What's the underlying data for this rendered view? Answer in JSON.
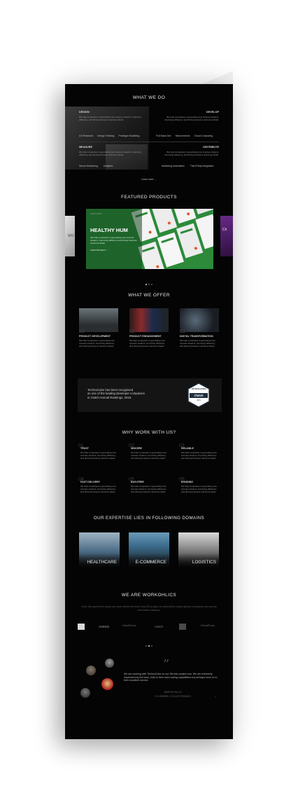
{
  "what_we_do": {
    "title": "WHAT WE DO",
    "blocks": [
      {
        "label": "DESIGN",
        "text": "We help companies in generating new revenue streams, improving efficiency, and driving business outcomes faster.",
        "items": [
          "UX Research",
          "Design Thinking",
          "Prototype Modelling"
        ]
      },
      {
        "label": "DEVELOP",
        "text": "We help companies in generating new revenue streams, improving efficiency, and driving business outcomes faster.",
        "items": [
          "Full Stack Dev",
          "Microservices",
          "Cloud Computing"
        ]
      },
      {
        "label": "MEASURE",
        "text": "We help companies in generating new revenue streams, improving efficiency, and driving business outcomes faster.",
        "items": [
          "Server Monitoring",
          "Analytics"
        ]
      },
      {
        "label": "DISTRIBUTE",
        "text": "We help companies in generating new revenue streams, improving efficiency, and driving business outcomes faster.",
        "items": [
          "Marketing Automation",
          "Third Party Integration"
        ]
      }
    ],
    "learn_more": "Learn more →"
  },
  "featured": {
    "title": "FEATURED PRODUCTS",
    "tag": "WATCHAPP",
    "product_title": "HEALTHY HUM",
    "product_text": "We help companies in generating new revenue streams, improving efficiency and driving business outcomes faster.",
    "link": "VIEW PROJECT →",
    "side_left": "WO",
    "side_right": "Ch"
  },
  "offer": {
    "title": "WHAT WE OFFER",
    "items": [
      {
        "num": "01",
        "title": "PRODUCT DEVELOPMENT",
        "text": "We help companies in generating new revenue streams, improving efficiency, and driving business outcomes faster."
      },
      {
        "num": "02",
        "title": "PRODUCT ENHANCEMENT",
        "text": "We help companies in generating new revenue streams, improving efficiency, and driving business outcomes faster."
      },
      {
        "num": "03",
        "title": "DIGITAL TRANSFORMATION",
        "text": "We help companies in generating new revenue streams, improving efficiency, and driving business outcomes faster."
      }
    ]
  },
  "clutch": {
    "line1": "TechnoCube has been recognised",
    "line2": "as one of the leading developer companies",
    "line3": "in Clutch Annual Rankings, 2019.",
    "badge_top": "TOP DEVELOPERS",
    "badge_name": "Clutch",
    "badge_year": "2019"
  },
  "why": {
    "title": "WHY WORK WITH US?",
    "items": [
      {
        "num": "01",
        "title": "TRUST",
        "text": "We help companies in generating new revenue streams, improving efficiency, and driving business outcomes faster."
      },
      {
        "num": "02",
        "title": "SINCERE",
        "text": "We help companies in generating new revenue streams, improving efficiency, and driving business outcomes faster."
      },
      {
        "num": "03",
        "title": "RELIABLE",
        "text": "We help companies in generating new revenue streams, improving efficiency, and driving business outcomes faster."
      },
      {
        "num": "04",
        "title": "FAST DELIVERY",
        "text": "We help companies in generating new revenue streams, improving efficiency, and driving business outcomes faster."
      },
      {
        "num": "05",
        "title": "BUG-FREE",
        "text": "We help companies in generating new revenue streams, improving efficiency, and driving business outcomes faster."
      },
      {
        "num": "06",
        "title": "BONDING",
        "text": "We help companies in generating new revenue streams, improving efficiency, and driving business outcomes faster."
      }
    ]
  },
  "domains": {
    "title": "OUR EXPERTISE LIES IN FOLLOWING DOMAINS",
    "items": [
      "HEALTHCARE",
      "E-COMMERCE",
      "LOGISTICS"
    ]
  },
  "workoholics": {
    "title": "WE ARE WORKOHLICS",
    "text": "Over the past three years we have delivered more than 50 project to multi-billion dollar global companies as well as innovative startups.",
    "logos": [
      "XSEED",
      "WordPress",
      "UBER",
      "",
      "WordPress"
    ]
  },
  "testimonial": {
    "quote": "We are working with TechnoCube on our 5th sub-project now. We are extremely impressed by the team, both in their hard coding capabilities but perhaps more so in their excellent service.",
    "name": "MARTIN FALCH",
    "role": "CO-OWNER, CO ELECTRONICS",
    "quote_mark": "”"
  },
  "colors": {
    "bg": "#040404",
    "green": "#2f8a3c",
    "panel": "#141414"
  }
}
